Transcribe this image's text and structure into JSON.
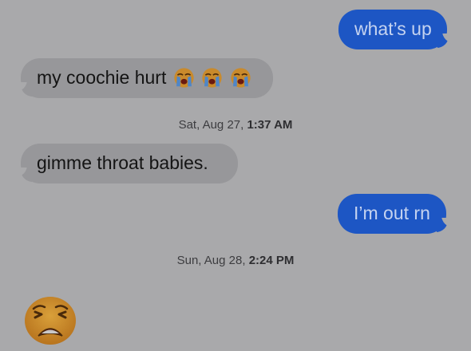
{
  "messages": {
    "m1": {
      "text": "what’s up",
      "direction": "sent"
    },
    "m2": {
      "text": "my coochie hurt",
      "emoji": [
        "crying-face",
        "crying-face",
        "crying-face"
      ],
      "direction": "received"
    },
    "m3": {
      "text": "gimme throat babies.",
      "direction": "received"
    },
    "m4": {
      "text": "I’m out rn",
      "direction": "sent"
    },
    "m5": {
      "emoji": "weary-face",
      "direction": "received"
    }
  },
  "timestamps": {
    "t1": {
      "day": "Sat, Aug 27,",
      "time": "1:37 AM"
    },
    "t2": {
      "day": "Sun, Aug 28,",
      "time": "2:24 PM"
    }
  },
  "colors": {
    "background": "#a9a9ab",
    "sent_bubble": "#1d56c4",
    "received_bubble": "#97979a"
  }
}
